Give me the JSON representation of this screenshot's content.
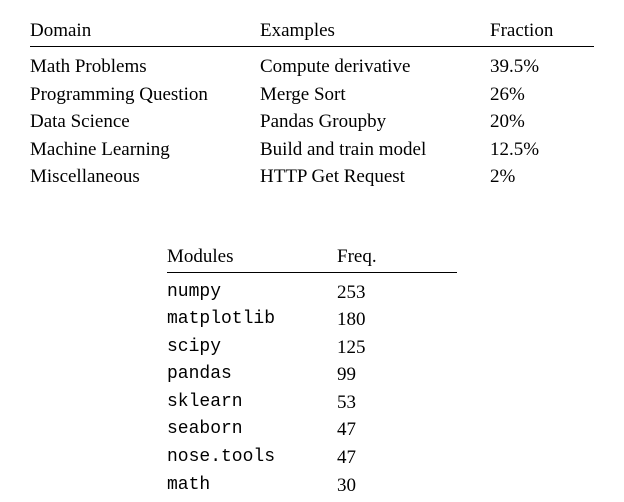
{
  "chart_data": [
    {
      "type": "table",
      "headers": [
        "Domain",
        "Examples",
        "Fraction"
      ],
      "rows": [
        [
          "Math Problems",
          "Compute derivative",
          "39.5%"
        ],
        [
          "Programming Question",
          "Merge Sort",
          "26%"
        ],
        [
          "Data Science",
          "Pandas Groupby",
          "20%"
        ],
        [
          "Machine Learning",
          "Build and train model",
          "12.5%"
        ],
        [
          "Miscellaneous",
          "HTTP Get Request",
          "2%"
        ]
      ]
    },
    {
      "type": "table",
      "headers": [
        "Modules",
        "Freq."
      ],
      "rows": [
        [
          "numpy",
          "253"
        ],
        [
          "matplotlib",
          "180"
        ],
        [
          "scipy",
          "125"
        ],
        [
          "pandas",
          "99"
        ],
        [
          "sklearn",
          "53"
        ],
        [
          "seaborn",
          "47"
        ],
        [
          "nose.tools",
          "47"
        ],
        [
          "math",
          "30"
        ]
      ]
    }
  ]
}
